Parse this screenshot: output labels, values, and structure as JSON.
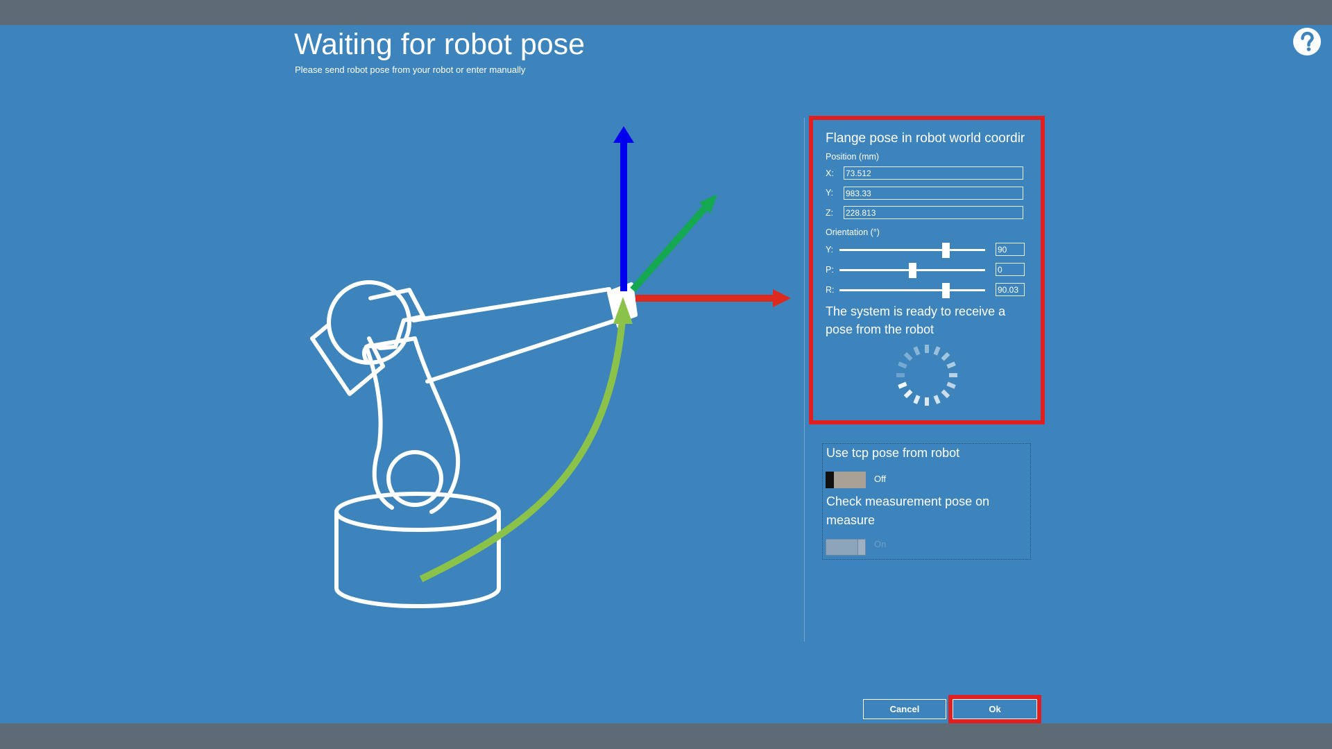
{
  "header": {
    "title": "Waiting for robot pose",
    "subtitle": "Please send robot pose from your robot or enter manually"
  },
  "help": {
    "icon": "question-icon"
  },
  "flange_panel": {
    "title": "Flange pose in robot world coordir",
    "position_label": "Position (mm)",
    "position": [
      {
        "label": "X:",
        "value": "73.512"
      },
      {
        "label": "Y:",
        "value": "983.33"
      },
      {
        "label": "Z:",
        "value": "228.813"
      }
    ],
    "orientation_label": "Orientation (°)",
    "orientation": [
      {
        "label": "Y:",
        "value": "90",
        "slider_fraction": 0.73
      },
      {
        "label": "P:",
        "value": "0",
        "slider_fraction": 0.5
      },
      {
        "label": "R:",
        "value": "90.03",
        "slider_fraction": 0.73
      }
    ],
    "status_text": "The system is ready to receive a pose from the robot",
    "spinner_icon": "loading-spinner-icon",
    "highlight_color": "#e02020"
  },
  "options": {
    "tcp_label": "Use tcp pose from robot",
    "tcp_state": "Off",
    "check_label": "Check measurement pose on measure",
    "check_state": "On"
  },
  "buttons": {
    "cancel": "Cancel",
    "ok": "Ok"
  },
  "colors": {
    "background": "#3d84bc",
    "bars": "#5c6b76",
    "axis_z": "#0000ee",
    "axis_x": "#dd2a1f",
    "axis_y": "#14a851",
    "trajectory": "#8bc34a",
    "highlight": "#e02020"
  }
}
